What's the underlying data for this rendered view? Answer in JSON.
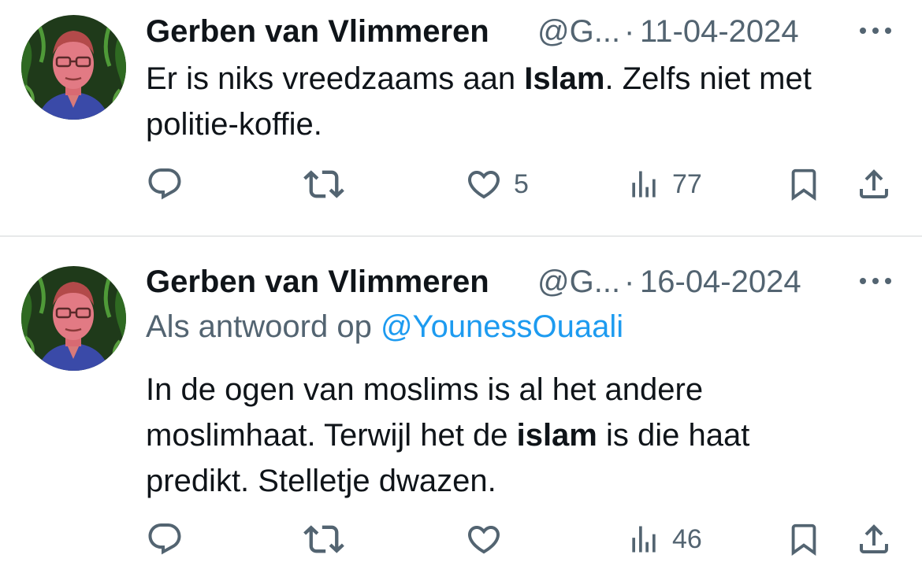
{
  "tweets": [
    {
      "author_name": "Gerben van Vlimmeren",
      "handle": "@G...",
      "separator": "·",
      "date": "11-04-2024",
      "reply_prefix": "",
      "reply_to": "",
      "text_lines": [
        [
          "Er is niks vreedzaams aan ",
          "Islam",
          ". Zelfs niet met"
        ],
        [
          "politie-koffie.",
          "",
          ""
        ]
      ],
      "likes": "5",
      "views": "77"
    },
    {
      "author_name": "Gerben van Vlimmeren",
      "handle": "@G...",
      "separator": "·",
      "date": "16-04-2024",
      "reply_prefix": "Als antwoord op ",
      "reply_to": "@YounessOuaali",
      "text_lines": [
        [
          "In de ogen van moslims is al het andere",
          "",
          ""
        ],
        [
          "moslimhaat. Terwijl het de ",
          "islam",
          " is die haat"
        ],
        [
          "predikt. Stelletje dwazen.",
          "",
          ""
        ]
      ],
      "likes": "",
      "views": "46"
    }
  ],
  "icons": {
    "more": "more-horizontal-icon",
    "reply": "reply-bubble-icon",
    "retweet": "retweet-icon",
    "like": "heart-icon",
    "views": "views-bar-chart-icon",
    "bookmark": "bookmark-icon",
    "share": "share-upload-icon"
  },
  "colors": {
    "text": "#0f1419",
    "secondary": "#536471",
    "link": "#1d9bf0",
    "divider": "#e7e9ea"
  }
}
